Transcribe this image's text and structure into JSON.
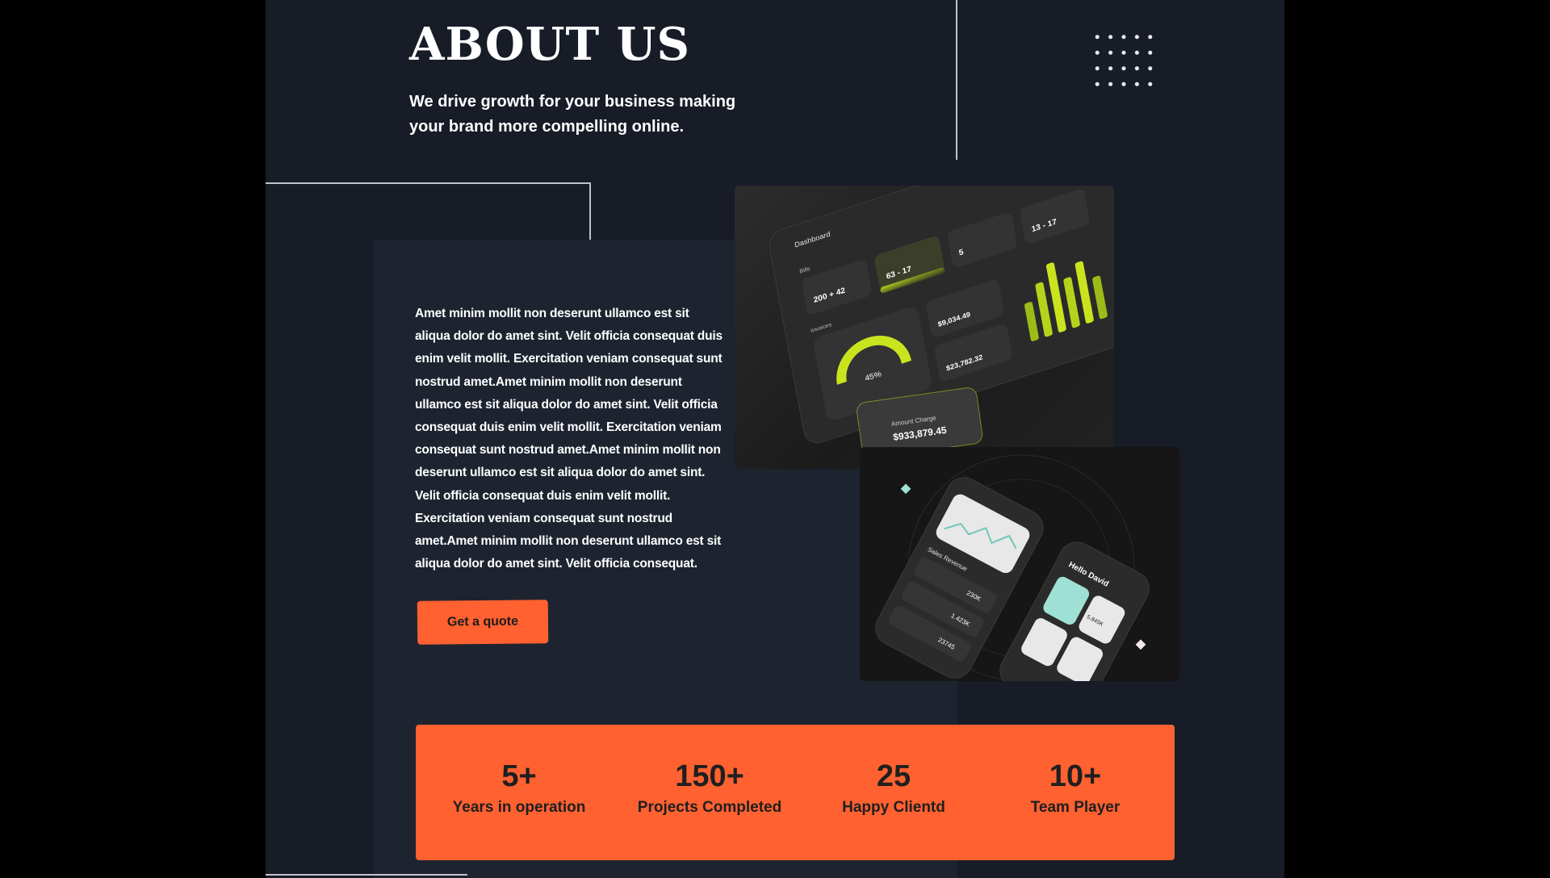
{
  "about": {
    "title": "ABOUT US",
    "subtitle": "We drive growth for your business making your brand more compelling online.",
    "body": "Amet minim mollit non deserunt ullamco est sit aliqua dolor do amet sint. Velit officia consequat duis enim velit mollit. Exercitation veniam consequat sunt nostrud amet.Amet minim mollit non deserunt ullamco est sit aliqua dolor do amet sint. Velit officia consequat duis enim velit mollit. Exercitation veniam consequat sunt nostrud amet.Amet minim mollit non deserunt ullamco est sit aliqua dolor do amet sint. Velit officia consequat duis enim velit mollit. Exercitation veniam consequat sunt nostrud amet.Amet minim mollit non deserunt ullamco est sit aliqua dolor do amet sint. Velit officia consequat.",
    "cta_label": "Get a quote"
  },
  "dashboard_mockup": {
    "header": "Dashboard",
    "bills_label": "Bills",
    "invoices_label": "Invoices",
    "tile_values": [
      "200 + 42",
      "63 - 17",
      "5",
      "13 - 17"
    ],
    "gauge_percent": "45%",
    "total_label": "$9,034.49",
    "balance_label": "$23,782.32",
    "amount_label": "Amount Charge",
    "amount_value": "$933,879.45"
  },
  "mobile_mockup": {
    "sales_label": "Sales Revenue",
    "greeting": "Hello David",
    "value_1": "230K",
    "value_2": "1.423K",
    "value_3": "23745",
    "value_4": "5.845K"
  },
  "stats": [
    {
      "value": "5+",
      "label": "Years in operation"
    },
    {
      "value": "150+",
      "label": "Projects Completed"
    },
    {
      "value": "25",
      "label": "Happy Clientd"
    },
    {
      "value": "10+",
      "label": "Team Player"
    }
  ],
  "colors": {
    "background": "#171c27",
    "panel": "#1d2430",
    "accent": "#ff6130",
    "lime": "#c9e41e",
    "mint": "#9fe0d4"
  }
}
